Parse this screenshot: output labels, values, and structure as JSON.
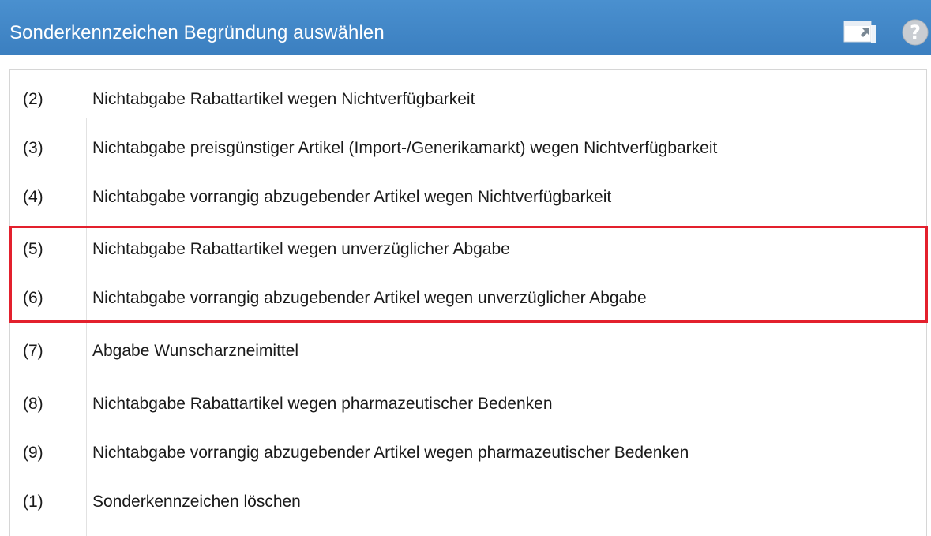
{
  "window": {
    "title": "Sonderkennzeichen Begründung auswählen"
  },
  "titlebar_icons": {
    "window_button": "window-arrow-icon",
    "help_button": "help-icon"
  },
  "colors": {
    "titlebar": "#3b7fc0",
    "highlight_border": "#e3202d",
    "text": "#1a1a1a"
  },
  "items": [
    {
      "code": "(2)",
      "label": "Nichtabgabe Rabattartikel wegen Nichtverfügbarkeit"
    },
    {
      "code": "(3)",
      "label": "Nichtabgabe preisgünstiger Artikel (Import-/Generikamarkt) wegen Nichtverfügbarkeit"
    },
    {
      "code": "(4)",
      "label": "Nichtabgabe vorrangig abzugebender Artikel wegen Nichtverfügbarkeit"
    },
    {
      "code": "(5)",
      "label": "Nichtabgabe Rabattartikel wegen unverzüglicher Abgabe"
    },
    {
      "code": "(6)",
      "label": "Nichtabgabe vorrangig abzugebender Artikel wegen unverzüglicher Abgabe"
    },
    {
      "code": "(7)",
      "label": "Abgabe Wunscharzneimittel"
    },
    {
      "code": "(8)",
      "label": "Nichtabgabe Rabattartikel wegen pharmazeutischer Bedenken"
    },
    {
      "code": "(9)",
      "label": "Nichtabgabe vorrangig abzugebender Artikel wegen pharmazeutischer Bedenken"
    },
    {
      "code": "(1)",
      "label": "Sonderkennzeichen löschen"
    }
  ]
}
